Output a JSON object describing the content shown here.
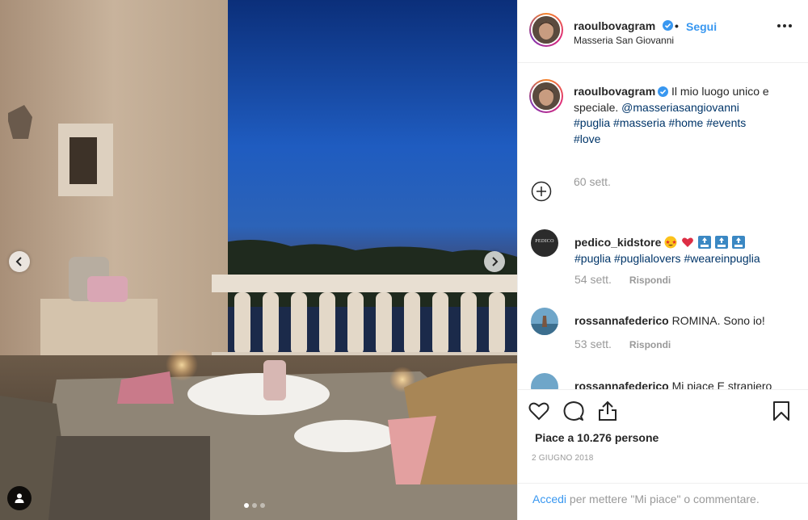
{
  "post": {
    "username": "raoulbovagram",
    "follow_label": "Segui",
    "bullet": "•",
    "location": "Masseria San Giovanni",
    "caption": {
      "text_pre": "Il mio luogo unico e speciale.",
      "mention": "@masseriasangiovanni",
      "hashtags": [
        "#puglia",
        "#masseria",
        "#home",
        "#events",
        "#love"
      ],
      "time": "60 sett."
    },
    "comments": [
      {
        "username": "pedico_kidstore",
        "avatar_text": "PEDICO",
        "hashtags": [
          "#puglia",
          "#puglialovers",
          "#weareinpuglia"
        ],
        "emojis": [
          "star-struck-emoji",
          "red-heart-emoji",
          "top-arrow-emoji",
          "top-arrow-emoji",
          "top-arrow-emoji"
        ],
        "time": "54 sett.",
        "reply_label": "Rispondi"
      },
      {
        "username": "rossannafederico",
        "text": "ROMINA. Sono io!",
        "time": "53 sett.",
        "reply_label": "Rispondi"
      },
      {
        "username": "rossannafederico",
        "text": "Mi piace E straniero"
      }
    ],
    "likes": "Piace a 10.276 persone",
    "date": "2 GIUGNO 2018",
    "login": {
      "link": "Accedi",
      "rest": " per mettere \"Mi piace\" o commentare."
    }
  },
  "carousel": {
    "dots": 3,
    "active_dot": 0
  },
  "colors": {
    "link_blue": "#3897f0",
    "hashtag": "#003569",
    "muted": "#999999",
    "border": "#efefef"
  }
}
